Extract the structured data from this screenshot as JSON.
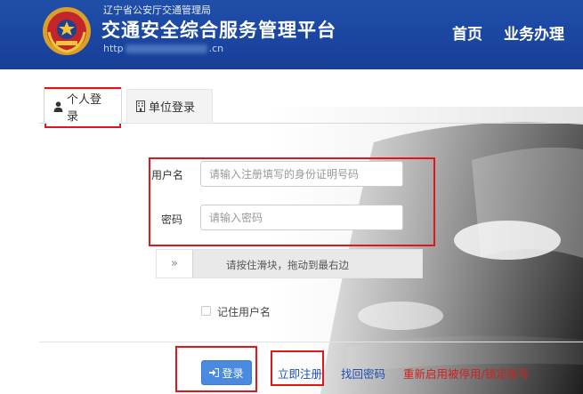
{
  "header": {
    "org_line": "辽宁省公安厅交通管理局",
    "title": "交通安全综合服务管理平台",
    "url_prefix": "http",
    "url_suffix": ".cn",
    "nav": [
      {
        "label": "首页"
      },
      {
        "label": "业务办理"
      }
    ]
  },
  "tabs": [
    {
      "label": "个人登录",
      "icon": "user-icon",
      "active": true
    },
    {
      "label": "单位登录",
      "icon": "building-icon",
      "active": false
    }
  ],
  "form": {
    "username": {
      "label": "用户名",
      "placeholder": "请输入注册填写的身份证明号码",
      "value": ""
    },
    "password": {
      "label": "密码",
      "placeholder": "请输入密码",
      "value": ""
    },
    "slider": {
      "handle": "»",
      "text": "请按住滑块，拖动到最右边"
    },
    "remember": {
      "label": "记住用户名",
      "checked": false
    }
  },
  "actions": {
    "login": "登录",
    "register": "立即注册",
    "recover": "找回密码",
    "unlock": "重新启用被停用/锁定账号"
  },
  "colors": {
    "header_bg": "#1a45a0",
    "login_button": "#4a8be0",
    "link_blue": "#1d4fb3",
    "link_red": "#d12020",
    "annotation_red": "#e0161b"
  }
}
